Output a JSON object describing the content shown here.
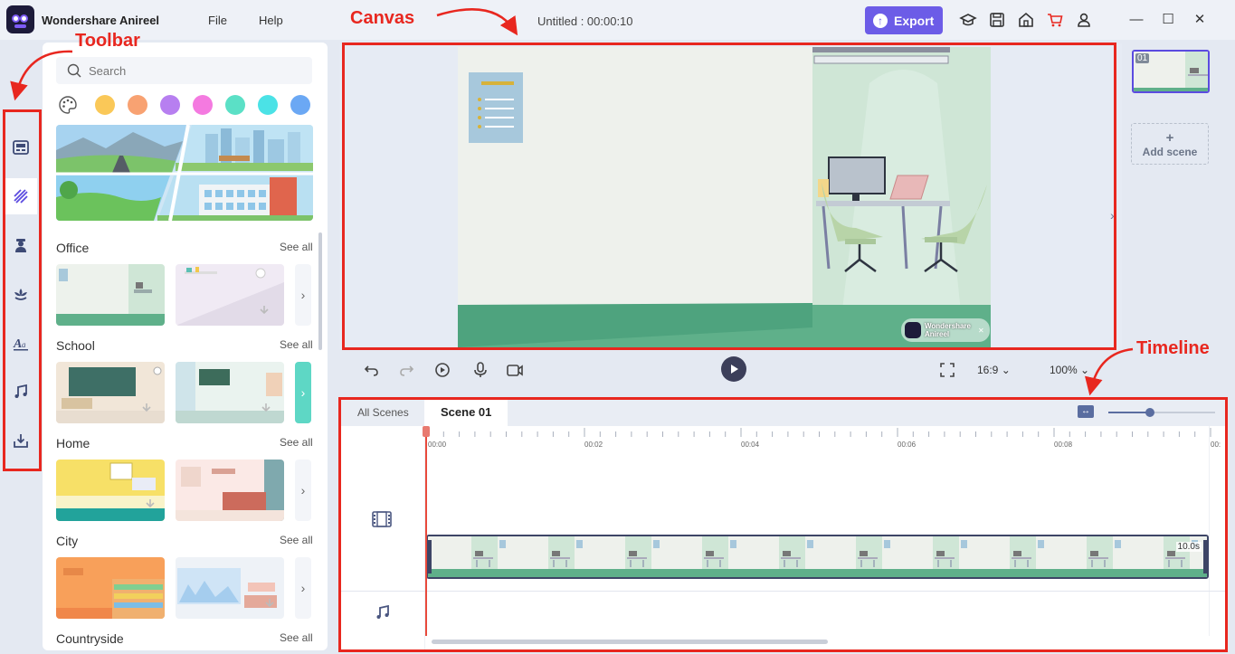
{
  "app": {
    "title": "Wondershare Anireel",
    "menus": [
      "File",
      "Help"
    ],
    "document_title": "Untitled : 00:00:10",
    "export_label": "Export"
  },
  "library": {
    "search_placeholder": "Search",
    "colors": [
      "#fac858",
      "#f8a272",
      "#b77ff0",
      "#f47ae0",
      "#5be0c6",
      "#4be2e6",
      "#6ba8f4"
    ],
    "categories": [
      {
        "title": "Office",
        "see_all": "See all"
      },
      {
        "title": "School",
        "see_all": "See all"
      },
      {
        "title": "Home",
        "see_all": "See all"
      },
      {
        "title": "City",
        "see_all": "See all"
      },
      {
        "title": "Countryside",
        "see_all": "See all"
      }
    ]
  },
  "canvas": {
    "watermark_line1": "Wondershare",
    "watermark_line2": "Anireel"
  },
  "playback": {
    "aspect_ratio": "16:9",
    "zoom": "100%"
  },
  "scenes": {
    "items": [
      {
        "number": "01"
      }
    ],
    "add_label": "Add scene",
    "add_plus": "+"
  },
  "timeline": {
    "tabs": [
      "All Scenes",
      "Scene 01"
    ],
    "ticks": [
      "00:00",
      "00:02",
      "00:04",
      "00:06",
      "00:08",
      "00:"
    ],
    "clip_duration": "10.0s"
  },
  "annotations": {
    "toolbar": "Toolbar",
    "canvas": "Canvas",
    "timeline": "Timeline"
  }
}
